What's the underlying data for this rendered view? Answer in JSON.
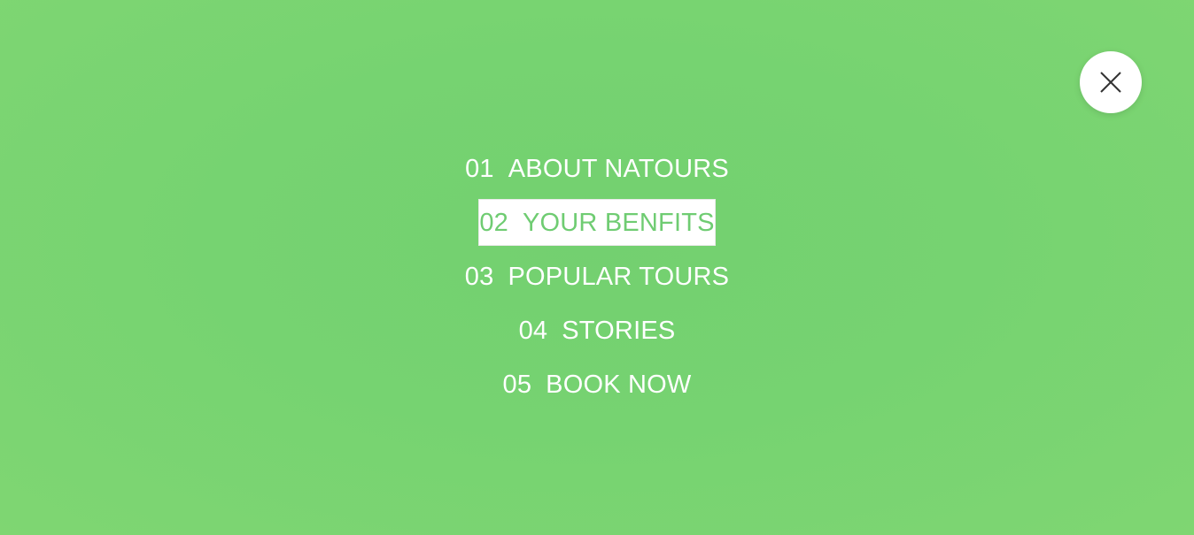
{
  "colors": {
    "background": "#76d371",
    "text": "#ffffff",
    "active_text": "#6fcc72",
    "active_background": "#ffffff"
  },
  "close_button": {
    "icon": "close-icon"
  },
  "nav": {
    "items": [
      {
        "number": "01",
        "label": "ABOUT NATOURS",
        "active": false
      },
      {
        "number": "02",
        "label": "YOUR BENFITS",
        "active": true
      },
      {
        "number": "03",
        "label": "POPULAR TOURS",
        "active": false
      },
      {
        "number": "04",
        "label": "STORIES",
        "active": false
      },
      {
        "number": "05",
        "label": "BOOK NOW",
        "active": false
      }
    ]
  }
}
